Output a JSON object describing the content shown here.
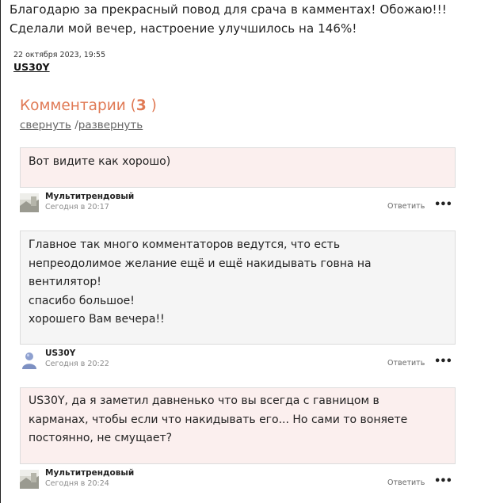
{
  "post": {
    "text": "Благодарю за прекрасный повод для срача в камментах! Обожаю!!! Сделали мой вечер, настроение улучшилось на 146%!",
    "date": "22 октября 2023, 19:55",
    "author": "US30Y"
  },
  "comments_header": {
    "label": "Комментарии (",
    "count": "3",
    "close": " )",
    "collapse": "свернуть",
    "separator": "/",
    "expand": "развернуть"
  },
  "comments": [
    {
      "lines": [
        "Вот видите как хорошо)"
      ],
      "author": "Мультитрендовый",
      "time": "Сегодня в 20:17",
      "reply": "Ответить",
      "more": "•••"
    },
    {
      "lines": [
        "Главное так много комментаторов ведутся, что есть",
        "непреодолимое желание ещё и ещё накидывать говна на",
        "вентилятор!",
        "спасибо большое!",
        "хорошего Вам вечера!!"
      ],
      "author": "US30Y",
      "time": "Сегодня в 20:22",
      "reply": "Ответить",
      "more": "•••"
    },
    {
      "lines": [
        "US30Y, да я заметил давненько что вы всегда с гавницом в",
        "карманах, чтобы если что накидывать его... Но сами то воняете",
        "постоянно, не смущает?"
      ],
      "author": "Мультитрендовый",
      "time": "Сегодня в 20:24",
      "reply": "Ответить",
      "more": "•••"
    }
  ]
}
